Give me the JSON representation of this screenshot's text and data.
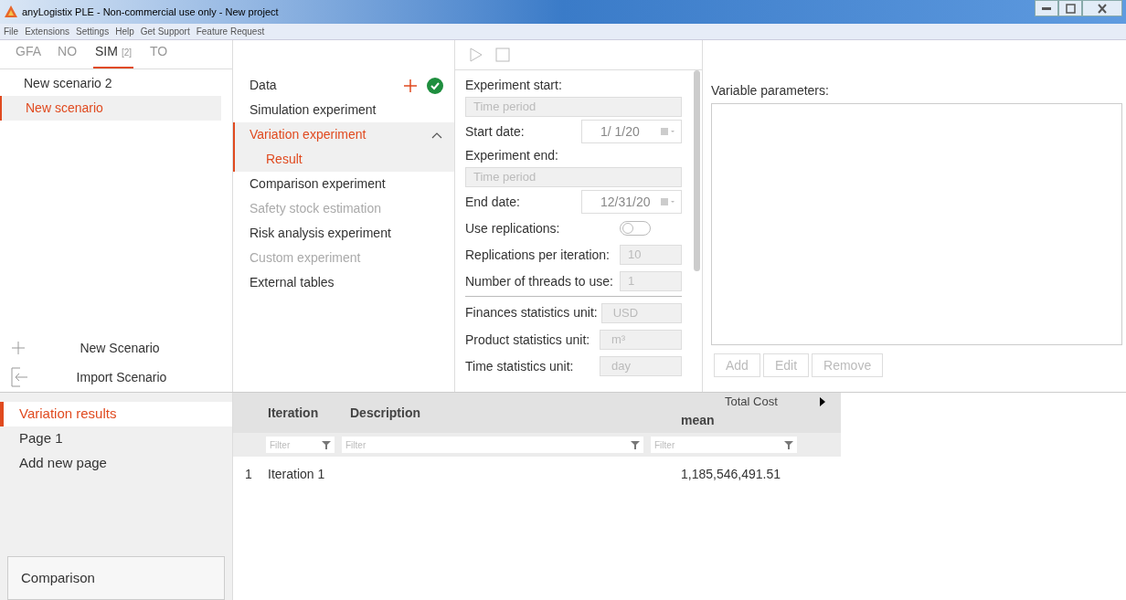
{
  "window": {
    "title": "anyLogistix PLE - Non-commercial use only - New project"
  },
  "menu": [
    "File",
    "Extensions",
    "Settings",
    "Help",
    "Get Support",
    "Feature Request"
  ],
  "tabs": [
    {
      "label": "GFA",
      "selected": false
    },
    {
      "label": "NO",
      "selected": false
    },
    {
      "label": "SIM",
      "count": "[2]",
      "selected": true
    },
    {
      "label": "TO",
      "selected": false
    }
  ],
  "scenarios": [
    {
      "label": "New scenario 2",
      "selected": false
    },
    {
      "label": "New scenario",
      "selected": true
    }
  ],
  "scenario_actions": [
    {
      "kind": "new",
      "label": "New Scenario"
    },
    {
      "kind": "import",
      "label": "Import Scenario"
    }
  ],
  "nav": [
    {
      "label": "Data",
      "selected": false,
      "disabled": false,
      "kind": "data"
    },
    {
      "label": "Simulation experiment",
      "selected": false,
      "disabled": false
    },
    {
      "label": "Variation experiment",
      "selected": true,
      "disabled": false,
      "expanded": true,
      "children": [
        {
          "label": "Result",
          "selected": true,
          "disabled": false
        }
      ]
    },
    {
      "label": "Comparison experiment",
      "selected": false,
      "disabled": false
    },
    {
      "label": "Safety stock estimation",
      "selected": false,
      "disabled": true
    },
    {
      "label": "Risk analysis experiment",
      "selected": false,
      "disabled": false
    },
    {
      "label": "Custom experiment",
      "selected": false,
      "disabled": true
    },
    {
      "label": "External tables",
      "selected": false,
      "disabled": false
    }
  ],
  "form": [
    {
      "kind": "heading",
      "label": "Experiment start:"
    },
    {
      "kind": "field",
      "placeholder": "Time period"
    },
    {
      "kind": "date",
      "label": "Start date:",
      "value": "1/ 1/20"
    },
    {
      "kind": "heading",
      "label": "Experiment end:"
    },
    {
      "kind": "field",
      "placeholder": "Time period"
    },
    {
      "kind": "date",
      "label": "End date:",
      "value": "12/31/20"
    },
    {
      "kind": "toggle",
      "label": "Use replications:",
      "on": false
    },
    {
      "kind": "number",
      "label": "Replications per iteration:",
      "value": "10",
      "disabled": true
    },
    {
      "kind": "number",
      "label": "Number of threads to use:",
      "value": "1",
      "disabled": true
    },
    {
      "kind": "unit",
      "label": "Finances statistics unit:",
      "value": "USD",
      "disabled": true
    },
    {
      "kind": "unit",
      "label": "Product statistics unit:",
      "value": "m³",
      "disabled": true
    },
    {
      "kind": "unit",
      "label": "Time statistics unit:",
      "value": "day",
      "disabled": true
    }
  ],
  "variable_parameters": {
    "title": "Variable parameters:",
    "buttons": [
      "Add",
      "Edit",
      "Remove"
    ]
  },
  "pages": [
    {
      "label": "Variation results",
      "selected": true
    },
    {
      "label": "Page 1",
      "selected": false
    },
    {
      "label": "Add new page",
      "selected": false
    }
  ],
  "comparison": "Comparison",
  "table": {
    "group_header": "Total Cost",
    "columns": [
      "",
      "Iteration",
      "Description",
      "mean"
    ],
    "filter_placeholders": [
      "Filter",
      "Filter",
      "Filter"
    ],
    "rows": [
      [
        "1",
        "Iteration 1",
        "",
        "1,185,546,491.51"
      ]
    ]
  }
}
